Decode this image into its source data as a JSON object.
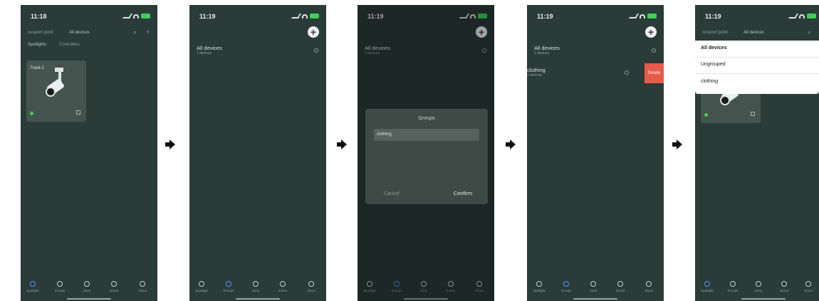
{
  "arrow_icon": "arrow-right-icon",
  "tabs": [
    "Spotlight",
    "Groups",
    "Zone",
    "Scene",
    "About"
  ],
  "screens": [
    {
      "time": "11:18",
      "header": {
        "site": "cuspont point",
        "selector": "All devices"
      },
      "sub_tabs": [
        "Spotlights",
        "Controllers"
      ],
      "device_card": {
        "name": "Track-1"
      }
    },
    {
      "time": "11:19",
      "group_row": {
        "title": "All devices",
        "sub": "1 devices"
      }
    },
    {
      "time": "11:19",
      "group_row": {
        "title": "All devices",
        "sub": "1 devices"
      },
      "dialog": {
        "title": "Groups",
        "input_value": "clothing",
        "cancel": "Cancel",
        "confirm": "Confirm"
      }
    },
    {
      "time": "11:19",
      "rows": [
        {
          "title": "All devices",
          "sub": "1 devices"
        },
        {
          "title": "clothing",
          "sub": "0 devices"
        }
      ],
      "delete_label": "Delete"
    },
    {
      "time": "11:19",
      "header": {
        "site": "cuspont point",
        "selector": "All devices"
      },
      "dropdown_options": [
        "All devices",
        "Ungrouped",
        "clothing"
      ]
    }
  ]
}
